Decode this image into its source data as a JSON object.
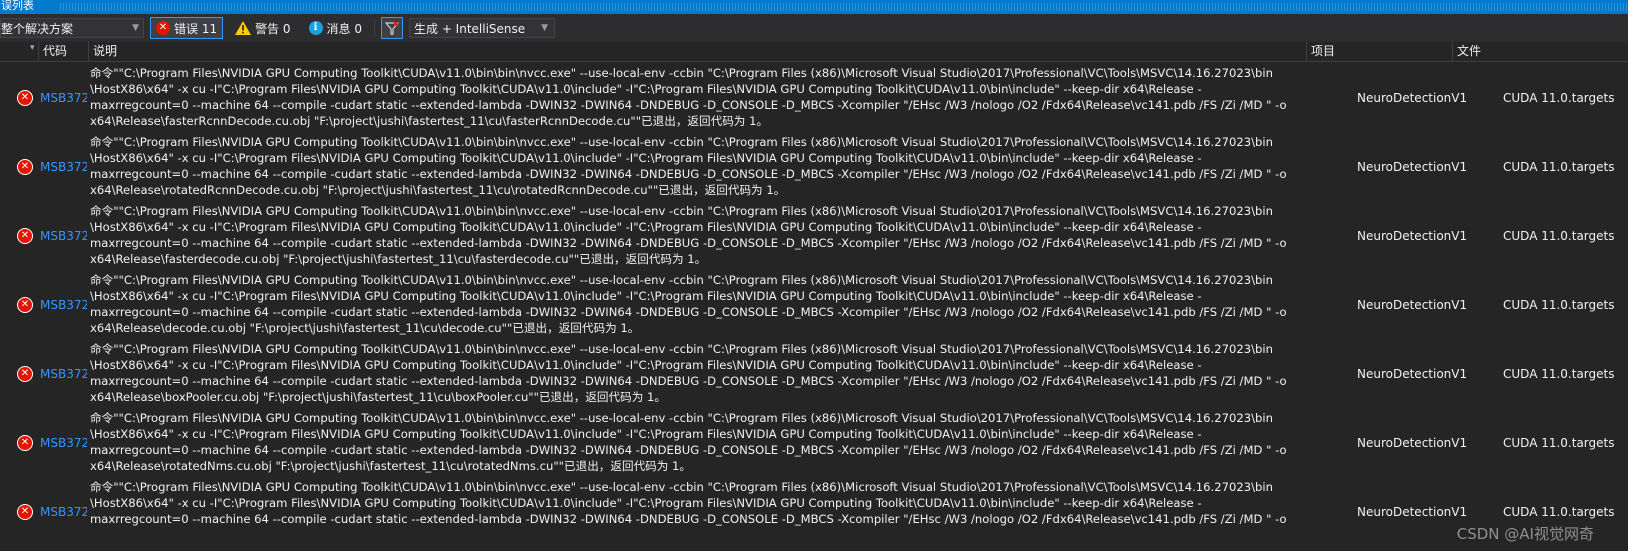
{
  "panel_title": "误列表",
  "toolbar": {
    "scope": "整个解决方案",
    "errors_label": "错误 11",
    "warnings_label": "警告 0",
    "messages_label": "消息 0",
    "build_filter": "生成 + IntelliSense",
    "icons": {
      "error": "error-circle-icon",
      "warning": "warning-triangle-icon",
      "info": "info-circle-icon",
      "filter": "filter-icon"
    }
  },
  "columns": {
    "code": "代码",
    "description": "说明",
    "project": "项目",
    "file": "文件"
  },
  "rows": [
    {
      "code": "MSB3721",
      "project": "NeuroDetectionV1",
      "file": "CUDA 11.0.targets",
      "lines": [
        "命令\"\"C:\\Program Files\\NVIDIA GPU Computing Toolkit\\CUDA\\v11.0\\bin\\bin\\nvcc.exe\"  --use-local-env -ccbin \"C:\\Program Files (x86)\\Microsoft Visual Studio\\2017\\Professional\\VC\\Tools\\MSVC\\14.16.27023\\bin",
        "\\HostX86\\x64\" -x cu   -I\"C:\\Program Files\\NVIDIA GPU Computing Toolkit\\CUDA\\v11.0\\include\" -I\"C:\\Program Files\\NVIDIA GPU Computing Toolkit\\CUDA\\v11.0\\bin\\include\"     --keep-dir x64\\Release -",
        "maxrregcount=0  --machine 64 --compile -cudart static --extended-lambda    -DWIN32 -DWIN64 -DNDEBUG -D_CONSOLE -D_MBCS -Xcompiler \"/EHsc /W3 /nologo /O2 /Fdx64\\Release\\vc141.pdb /FS /Zi  /MD \" -o",
        "x64\\Release\\fasterRcnnDecode.cu.obj \"F:\\project\\jushi\\fastertest_11\\cu\\fasterRcnnDecode.cu\"\"已退出，返回代码为 1。"
      ]
    },
    {
      "code": "MSB3721",
      "project": "NeuroDetectionV1",
      "file": "CUDA 11.0.targets",
      "lines": [
        "命令\"\"C:\\Program Files\\NVIDIA GPU Computing Toolkit\\CUDA\\v11.0\\bin\\bin\\nvcc.exe\"  --use-local-env -ccbin \"C:\\Program Files (x86)\\Microsoft Visual Studio\\2017\\Professional\\VC\\Tools\\MSVC\\14.16.27023\\bin",
        "\\HostX86\\x64\" -x cu   -I\"C:\\Program Files\\NVIDIA GPU Computing Toolkit\\CUDA\\v11.0\\include\" -I\"C:\\Program Files\\NVIDIA GPU Computing Toolkit\\CUDA\\v11.0\\bin\\include\"     --keep-dir x64\\Release -",
        "maxrregcount=0  --machine 64 --compile -cudart static --extended-lambda    -DWIN32 -DWIN64 -DNDEBUG -D_CONSOLE -D_MBCS -Xcompiler \"/EHsc /W3 /nologo /O2 /Fdx64\\Release\\vc141.pdb /FS /Zi  /MD \" -o",
        "x64\\Release\\rotatedRcnnDecode.cu.obj \"F:\\project\\jushi\\fastertest_11\\cu\\rotatedRcnnDecode.cu\"\"已退出，返回代码为 1。"
      ]
    },
    {
      "code": "MSB3721",
      "project": "NeuroDetectionV1",
      "file": "CUDA 11.0.targets",
      "lines": [
        "命令\"\"C:\\Program Files\\NVIDIA GPU Computing Toolkit\\CUDA\\v11.0\\bin\\bin\\nvcc.exe\"  --use-local-env -ccbin \"C:\\Program Files (x86)\\Microsoft Visual Studio\\2017\\Professional\\VC\\Tools\\MSVC\\14.16.27023\\bin",
        "\\HostX86\\x64\" -x cu   -I\"C:\\Program Files\\NVIDIA GPU Computing Toolkit\\CUDA\\v11.0\\include\" -I\"C:\\Program Files\\NVIDIA GPU Computing Toolkit\\CUDA\\v11.0\\bin\\include\"     --keep-dir x64\\Release -",
        "maxrregcount=0  --machine 64 --compile -cudart static --extended-lambda    -DWIN32 -DWIN64 -DNDEBUG -D_CONSOLE -D_MBCS -Xcompiler \"/EHsc /W3 /nologo /O2 /Fdx64\\Release\\vc141.pdb /FS /Zi  /MD \" -o",
        "x64\\Release\\fasterdecode.cu.obj \"F:\\project\\jushi\\fastertest_11\\cu\\fasterdecode.cu\"\"已退出，返回代码为 1。"
      ]
    },
    {
      "code": "MSB3721",
      "project": "NeuroDetectionV1",
      "file": "CUDA 11.0.targets",
      "lines": [
        "命令\"\"C:\\Program Files\\NVIDIA GPU Computing Toolkit\\CUDA\\v11.0\\bin\\bin\\nvcc.exe\"  --use-local-env -ccbin \"C:\\Program Files (x86)\\Microsoft Visual Studio\\2017\\Professional\\VC\\Tools\\MSVC\\14.16.27023\\bin",
        "\\HostX86\\x64\" -x cu   -I\"C:\\Program Files\\NVIDIA GPU Computing Toolkit\\CUDA\\v11.0\\include\" -I\"C:\\Program Files\\NVIDIA GPU Computing Toolkit\\CUDA\\v11.0\\bin\\include\"     --keep-dir x64\\Release -",
        "maxrregcount=0  --machine 64 --compile -cudart static --extended-lambda    -DWIN32 -DWIN64 -DNDEBUG -D_CONSOLE -D_MBCS -Xcompiler \"/EHsc /W3 /nologo /O2 /Fdx64\\Release\\vc141.pdb /FS /Zi  /MD \" -o",
        "x64\\Release\\decode.cu.obj \"F:\\project\\jushi\\fastertest_11\\cu\\decode.cu\"\"已退出，返回代码为 1。"
      ]
    },
    {
      "code": "MSB3721",
      "project": "NeuroDetectionV1",
      "file": "CUDA 11.0.targets",
      "lines": [
        "命令\"\"C:\\Program Files\\NVIDIA GPU Computing Toolkit\\CUDA\\v11.0\\bin\\bin\\nvcc.exe\"  --use-local-env -ccbin \"C:\\Program Files (x86)\\Microsoft Visual Studio\\2017\\Professional\\VC\\Tools\\MSVC\\14.16.27023\\bin",
        "\\HostX86\\x64\" -x cu   -I\"C:\\Program Files\\NVIDIA GPU Computing Toolkit\\CUDA\\v11.0\\include\" -I\"C:\\Program Files\\NVIDIA GPU Computing Toolkit\\CUDA\\v11.0\\bin\\include\"     --keep-dir x64\\Release -",
        "maxrregcount=0  --machine 64 --compile -cudart static --extended-lambda    -DWIN32 -DWIN64 -DNDEBUG -D_CONSOLE -D_MBCS -Xcompiler \"/EHsc /W3 /nologo /O2 /Fdx64\\Release\\vc141.pdb /FS /Zi  /MD \" -o",
        "x64\\Release\\boxPooler.cu.obj \"F:\\project\\jushi\\fastertest_11\\cu\\boxPooler.cu\"\"已退出，返回代码为 1。"
      ]
    },
    {
      "code": "MSB3721",
      "project": "NeuroDetectionV1",
      "file": "CUDA 11.0.targets",
      "lines": [
        "命令\"\"C:\\Program Files\\NVIDIA GPU Computing Toolkit\\CUDA\\v11.0\\bin\\bin\\nvcc.exe\"  --use-local-env -ccbin \"C:\\Program Files (x86)\\Microsoft Visual Studio\\2017\\Professional\\VC\\Tools\\MSVC\\14.16.27023\\bin",
        "\\HostX86\\x64\" -x cu   -I\"C:\\Program Files\\NVIDIA GPU Computing Toolkit\\CUDA\\v11.0\\include\" -I\"C:\\Program Files\\NVIDIA GPU Computing Toolkit\\CUDA\\v11.0\\bin\\include\"     --keep-dir x64\\Release -",
        "maxrregcount=0  --machine 64 --compile -cudart static --extended-lambda    -DWIN32 -DWIN64 -DNDEBUG -D_CONSOLE -D_MBCS -Xcompiler \"/EHsc /W3 /nologo /O2 /Fdx64\\Release\\vc141.pdb /FS /Zi  /MD \" -o",
        "x64\\Release\\rotatedNms.cu.obj \"F:\\project\\jushi\\fastertest_11\\cu\\rotatedNms.cu\"\"已退出，返回代码为 1。"
      ]
    },
    {
      "code": "MSB3721",
      "project": "NeuroDetectionV1",
      "file": "CUDA 11.0.targets",
      "lines": [
        "命令\"\"C:\\Program Files\\NVIDIA GPU Computing Toolkit\\CUDA\\v11.0\\bin\\bin\\nvcc.exe\"  --use-local-env -ccbin \"C:\\Program Files (x86)\\Microsoft Visual Studio\\2017\\Professional\\VC\\Tools\\MSVC\\14.16.27023\\bin",
        "\\HostX86\\x64\" -x cu   -I\"C:\\Program Files\\NVIDIA GPU Computing Toolkit\\CUDA\\v11.0\\include\" -I\"C:\\Program Files\\NVIDIA GPU Computing Toolkit\\CUDA\\v11.0\\bin\\include\"     --keep-dir x64\\Release -",
        "maxrregcount=0  --machine 64 --compile -cudart static --extended-lambda    -DWIN32 -DWIN64 -DNDEBUG -D_CONSOLE -D_MBCS -Xcompiler \"/EHsc /W3 /nologo /O2 /Fdx64\\Release\\vc141.pdb /FS /Zi  /MD \" -o",
        ""
      ]
    }
  ],
  "watermark": "CSDN @AI视觉网奇",
  "colors": {
    "accent": "#007acc",
    "error": "#e51400",
    "link": "#3794ff",
    "background": "#252526"
  }
}
